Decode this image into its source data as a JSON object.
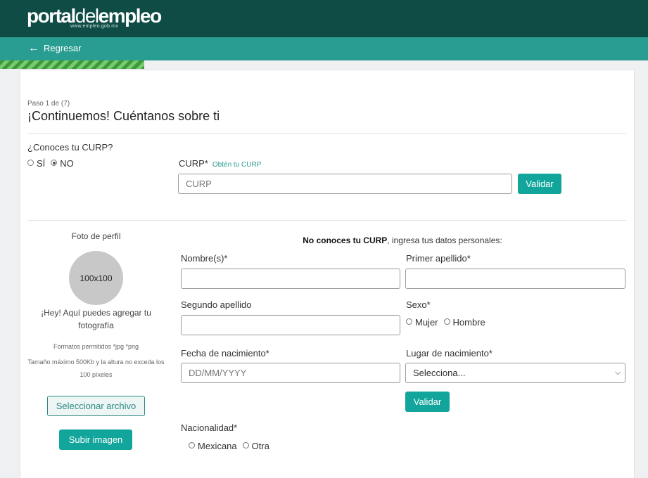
{
  "header": {
    "logo_bold": "portal",
    "logo_thin": "del",
    "logo_bold2": "empleo",
    "logo_url": "www.empleo.gob.mx",
    "back_label": "Regresar"
  },
  "progress": {
    "fraction": 0.2225
  },
  "form": {
    "step": "Paso 1 de (7)",
    "title": "¡Continuemos! Cuéntanos sobre ti",
    "curp_question": "¿Conoces tu CURP?",
    "curp_yes": "SÍ",
    "curp_no": "NO",
    "curp_selected": "NO",
    "curp_label": "CURP*",
    "curp_link": "Obtén tu CURP",
    "curp_placeholder": "CURP",
    "validate_label": "Validar",
    "hint_bold": "No conoces tu CURP",
    "hint_rest": ", ingresa tus datos personales:",
    "nombre_label": "Nombre(s)*",
    "primer_apellido_label": "Primer apellido*",
    "segundo_apellido_label": "Segundo apellido",
    "sexo_label": "Sexo*",
    "sexo_mujer": "Mujer",
    "sexo_hombre": "Hombre",
    "fecha_label": "Fecha de nacimiento*",
    "fecha_placeholder": "DD/MM/YYYY",
    "lugar_label": "Lugar de nacimiento*",
    "lugar_selected": "Selecciona...",
    "validate2_label": "Validar",
    "nacionalidad_label": "Nacionalidad*",
    "nac_mexicana": "Mexicana",
    "nac_otra": "Otra"
  },
  "photo": {
    "title": "Foto de perfil",
    "placeholder": "100x100",
    "prompt": "¡Hey! Aquí puedes agregar tu fotografía",
    "formats": "Formatos permitidos *jpg *png",
    "size_rule": "Tamaño máximo 500Kb y la altura no exceda los 100 píxeles",
    "select_file": "Seleccionar archivo",
    "upload": "Subir imagen"
  }
}
